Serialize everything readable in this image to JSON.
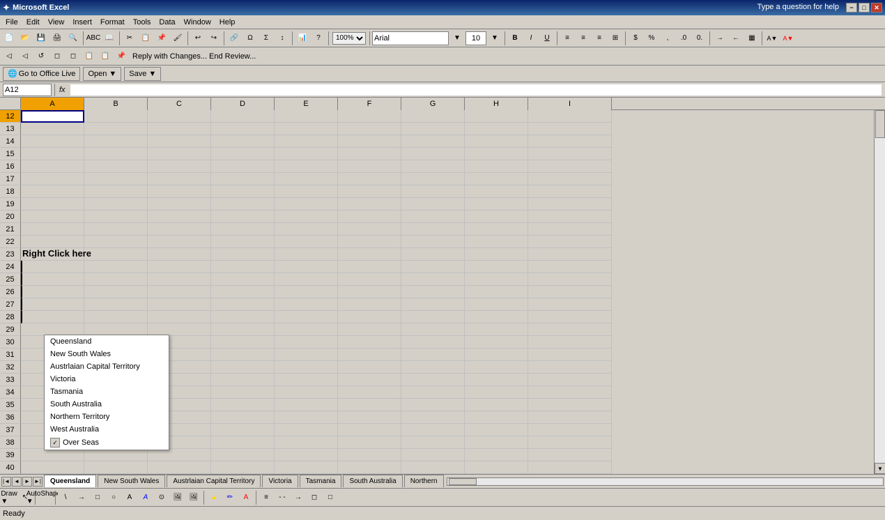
{
  "title_bar": {
    "title": "Microsoft Excel",
    "minimize_label": "−",
    "restore_label": "□",
    "close_label": "✕",
    "help_text": "Type a question for help"
  },
  "menu": {
    "items": [
      "File",
      "Edit",
      "View",
      "Insert",
      "Format",
      "Tools",
      "Data",
      "Window",
      "Help"
    ]
  },
  "formula_bar": {
    "name_box": "A12",
    "fx": "fx"
  },
  "columns": [
    "A",
    "B",
    "C",
    "D",
    "E",
    "F",
    "G",
    "H",
    "I"
  ],
  "rows": [
    {
      "num": 12,
      "selected": true
    },
    {
      "num": 13
    },
    {
      "num": 14
    },
    {
      "num": 15
    },
    {
      "num": 16
    },
    {
      "num": 17
    },
    {
      "num": 18
    },
    {
      "num": 19
    },
    {
      "num": 20
    },
    {
      "num": 21
    },
    {
      "num": 22
    },
    {
      "num": 23,
      "content": "Right Click here"
    },
    {
      "num": 24
    },
    {
      "num": 25
    },
    {
      "num": 26
    },
    {
      "num": 27
    },
    {
      "num": 28
    },
    {
      "num": 29
    },
    {
      "num": 30
    },
    {
      "num": 31
    },
    {
      "num": 32
    },
    {
      "num": 33
    },
    {
      "num": 34
    },
    {
      "num": 35
    },
    {
      "num": 36
    },
    {
      "num": 37
    },
    {
      "num": 38
    },
    {
      "num": 39
    },
    {
      "num": 40
    }
  ],
  "dropdown": {
    "items": [
      "Queensland",
      "New South Wales",
      "Austrlaian Capital Territory",
      "Victoria",
      "Tasmania",
      "South Australia",
      "Northern Territory",
      "West Australia",
      "Over Seas"
    ],
    "last_item_checked": true
  },
  "sheet_tabs": {
    "tabs": [
      "Queensland",
      "New South Wales",
      "Austrlaian Capital Territory",
      "Victoria",
      "Tasmania",
      "South Australia",
      "Northern"
    ],
    "active_index": 0
  },
  "status_bar": {
    "text": "Ready"
  },
  "draw_toolbar": {
    "draw_label": "Draw ▼",
    "autoshapes_label": "AutoShapes ▼"
  },
  "office_live": {
    "goto_label": "Go to Office Live",
    "open_label": "Open ▼",
    "save_label": "Save ▼"
  },
  "font": {
    "name": "Arial",
    "size": "10"
  }
}
